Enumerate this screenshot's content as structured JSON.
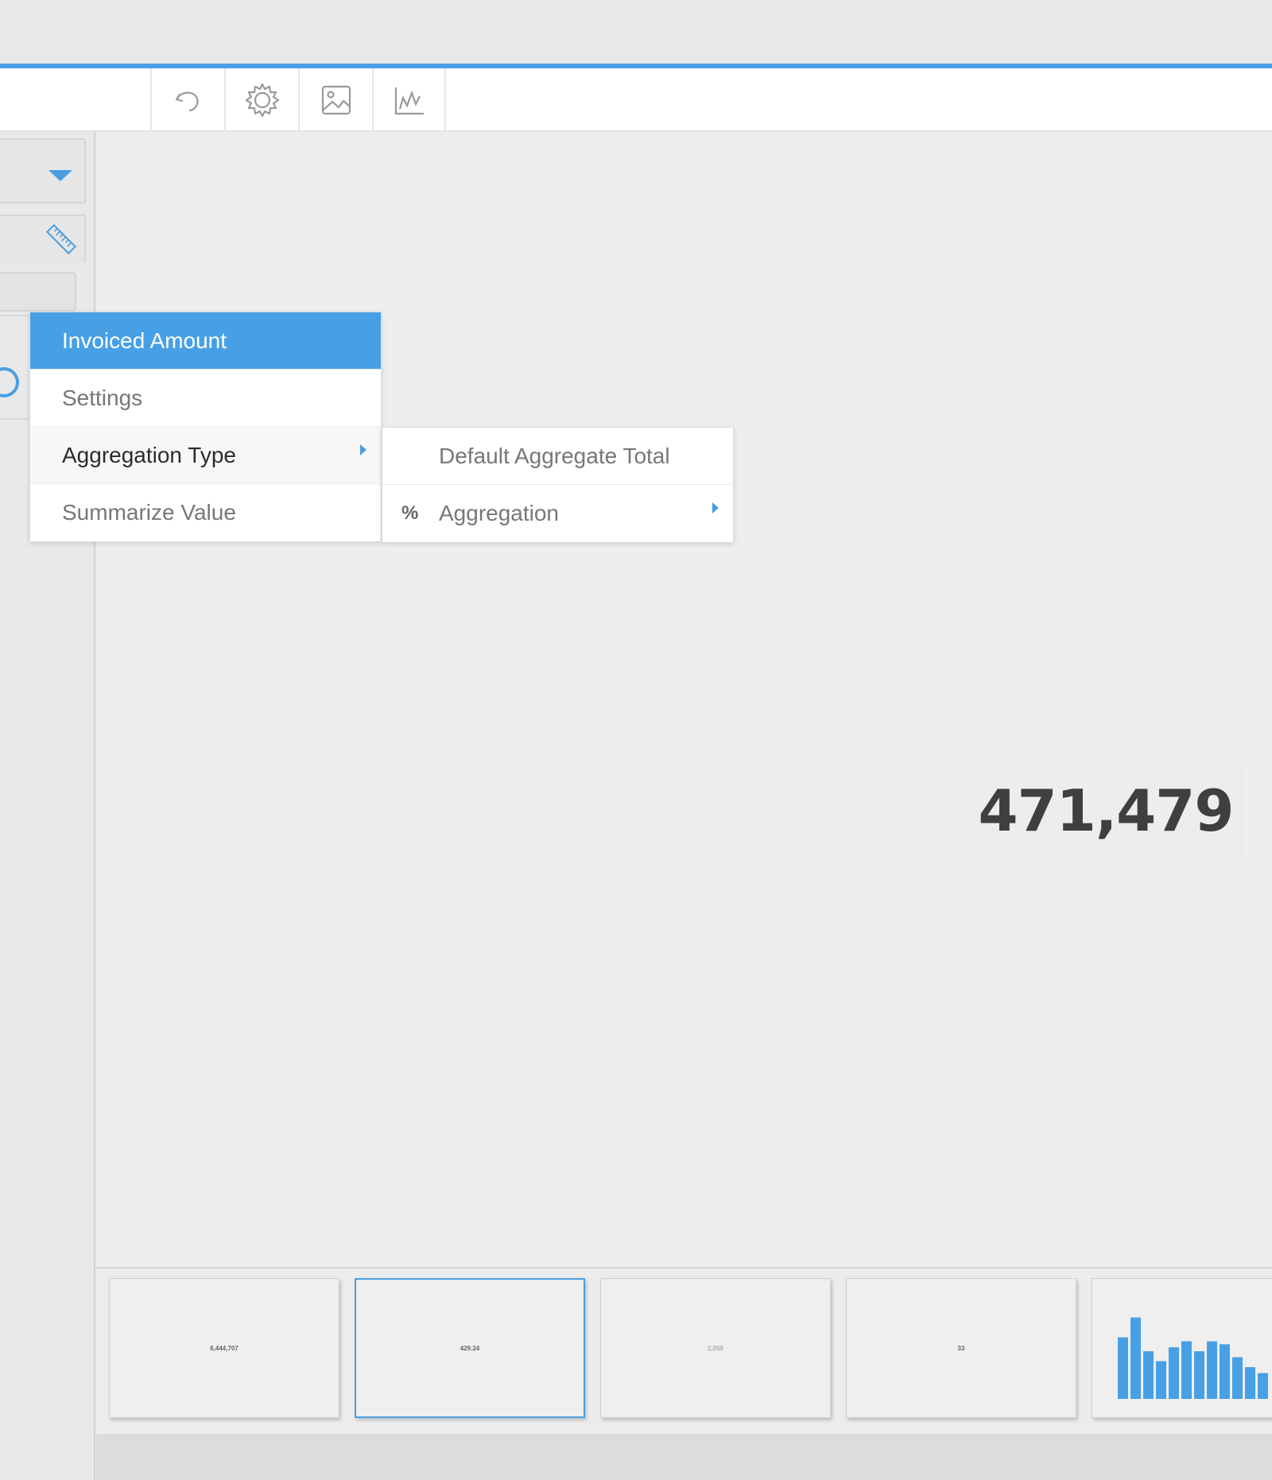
{
  "toolbar": {
    "icons": [
      "undo-icon",
      "gear-icon",
      "image-icon",
      "line-chart-icon"
    ]
  },
  "context_menu": {
    "header": "Invoiced Amount",
    "items": [
      {
        "label": "Settings"
      },
      {
        "label": "Aggregation Type",
        "has_submenu": true
      },
      {
        "label": "Summarize Value"
      }
    ]
  },
  "submenu": {
    "items": [
      {
        "label": "Default Aggregate Total"
      },
      {
        "label": "Aggregation",
        "icon": "%",
        "has_submenu": true
      }
    ]
  },
  "kpi": {
    "value": "471,479"
  },
  "filmstrip": {
    "thumbnails": [
      {
        "label": "6,444,707"
      },
      {
        "label": "429.24",
        "selected": true
      },
      {
        "label": "2,059"
      },
      {
        "label": "33"
      },
      {
        "type": "bar-chart",
        "bar_heights": [
          0.62,
          0.82,
          0.48,
          0.38,
          0.52,
          0.58,
          0.48,
          0.58,
          0.55,
          0.42,
          0.32,
          0.26
        ]
      }
    ]
  },
  "colors": {
    "accent": "#47a0e6",
    "selected_border": "#4a9ee0"
  }
}
